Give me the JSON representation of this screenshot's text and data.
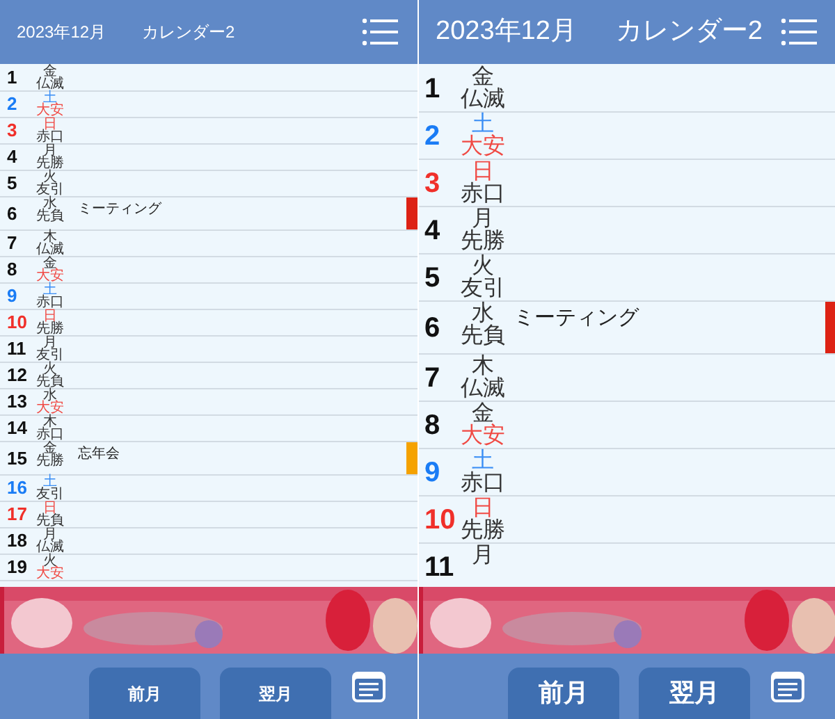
{
  "panels": [
    {
      "kind": "compact",
      "header": {
        "month": "2023年12月",
        "calendar_name": "カレンダー2"
      },
      "days": [
        {
          "day": "1",
          "weekday": "金",
          "kind": "weekday",
          "rokuyo": "仏滅",
          "rokuyo_highlighted": false
        },
        {
          "day": "2",
          "weekday": "土",
          "kind": "saturday",
          "rokuyo": "大安",
          "rokuyo_highlighted": true
        },
        {
          "day": "3",
          "weekday": "日",
          "kind": "sunday",
          "rokuyo": "赤口",
          "rokuyo_highlighted": false
        },
        {
          "day": "4",
          "weekday": "月",
          "kind": "weekday",
          "rokuyo": "先勝",
          "rokuyo_highlighted": false
        },
        {
          "day": "5",
          "weekday": "火",
          "kind": "weekday",
          "rokuyo": "友引",
          "rokuyo_highlighted": false
        },
        {
          "day": "6",
          "weekday": "水",
          "kind": "weekday",
          "rokuyo": "先負",
          "rokuyo_highlighted": false,
          "event": "ミーティング",
          "color": "#dd2214"
        },
        {
          "day": "7",
          "weekday": "木",
          "kind": "weekday",
          "rokuyo": "仏滅",
          "rokuyo_highlighted": false
        },
        {
          "day": "8",
          "weekday": "金",
          "kind": "weekday",
          "rokuyo": "大安",
          "rokuyo_highlighted": true
        },
        {
          "day": "9",
          "weekday": "土",
          "kind": "saturday",
          "rokuyo": "赤口",
          "rokuyo_highlighted": false
        },
        {
          "day": "10",
          "weekday": "日",
          "kind": "sunday",
          "rokuyo": "先勝",
          "rokuyo_highlighted": false
        },
        {
          "day": "11",
          "weekday": "月",
          "kind": "weekday",
          "rokuyo": "友引",
          "rokuyo_highlighted": false
        },
        {
          "day": "12",
          "weekday": "火",
          "kind": "weekday",
          "rokuyo": "先負",
          "rokuyo_highlighted": false
        },
        {
          "day": "13",
          "weekday": "水",
          "kind": "weekday",
          "rokuyo": "大安",
          "rokuyo_highlighted": true
        },
        {
          "day": "14",
          "weekday": "木",
          "kind": "weekday",
          "rokuyo": "赤口",
          "rokuyo_highlighted": false
        },
        {
          "day": "15",
          "weekday": "金",
          "kind": "weekday",
          "rokuyo": "先勝",
          "rokuyo_highlighted": false,
          "event": "忘年会",
          "color": "#f5a200"
        },
        {
          "day": "16",
          "weekday": "土",
          "kind": "saturday",
          "rokuyo": "友引",
          "rokuyo_highlighted": false
        },
        {
          "day": "17",
          "weekday": "日",
          "kind": "sunday",
          "rokuyo": "先負",
          "rokuyo_highlighted": false
        },
        {
          "day": "18",
          "weekday": "月",
          "kind": "weekday",
          "rokuyo": "仏滅",
          "rokuyo_highlighted": false
        },
        {
          "day": "19",
          "weekday": "火",
          "kind": "weekday",
          "rokuyo": "大安",
          "rokuyo_highlighted": true
        }
      ],
      "buttons": [
        "前月",
        "翌月"
      ]
    },
    {
      "kind": "large",
      "header": {
        "month": "2023年12月",
        "calendar_name": "カレンダー2"
      },
      "days": [
        {
          "day": "1",
          "weekday": "金",
          "kind": "weekday",
          "rokuyo": "仏滅",
          "rokuyo_highlighted": false
        },
        {
          "day": "2",
          "weekday": "土",
          "kind": "saturday",
          "rokuyo": "大安",
          "rokuyo_highlighted": true
        },
        {
          "day": "3",
          "weekday": "日",
          "kind": "sunday",
          "rokuyo": "赤口",
          "rokuyo_highlighted": false
        },
        {
          "day": "4",
          "weekday": "月",
          "kind": "weekday",
          "rokuyo": "先勝",
          "rokuyo_highlighted": false
        },
        {
          "day": "5",
          "weekday": "火",
          "kind": "weekday",
          "rokuyo": "友引",
          "rokuyo_highlighted": false
        },
        {
          "day": "6",
          "weekday": "水",
          "kind": "weekday",
          "rokuyo": "先負",
          "rokuyo_highlighted": false,
          "event": "ミーティング",
          "color": "#dd2214"
        },
        {
          "day": "7",
          "weekday": "木",
          "kind": "weekday",
          "rokuyo": "仏滅",
          "rokuyo_highlighted": false
        },
        {
          "day": "8",
          "weekday": "金",
          "kind": "weekday",
          "rokuyo": "大安",
          "rokuyo_highlighted": true
        },
        {
          "day": "9",
          "weekday": "土",
          "kind": "saturday",
          "rokuyo": "赤口",
          "rokuyo_highlighted": false
        },
        {
          "day": "10",
          "weekday": "日",
          "kind": "sunday",
          "rokuyo": "先勝",
          "rokuyo_highlighted": false
        },
        {
          "day": "11",
          "weekday": "月",
          "kind": "weekday"
        }
      ],
      "buttons": [
        "前月",
        "翌月"
      ]
    }
  ]
}
